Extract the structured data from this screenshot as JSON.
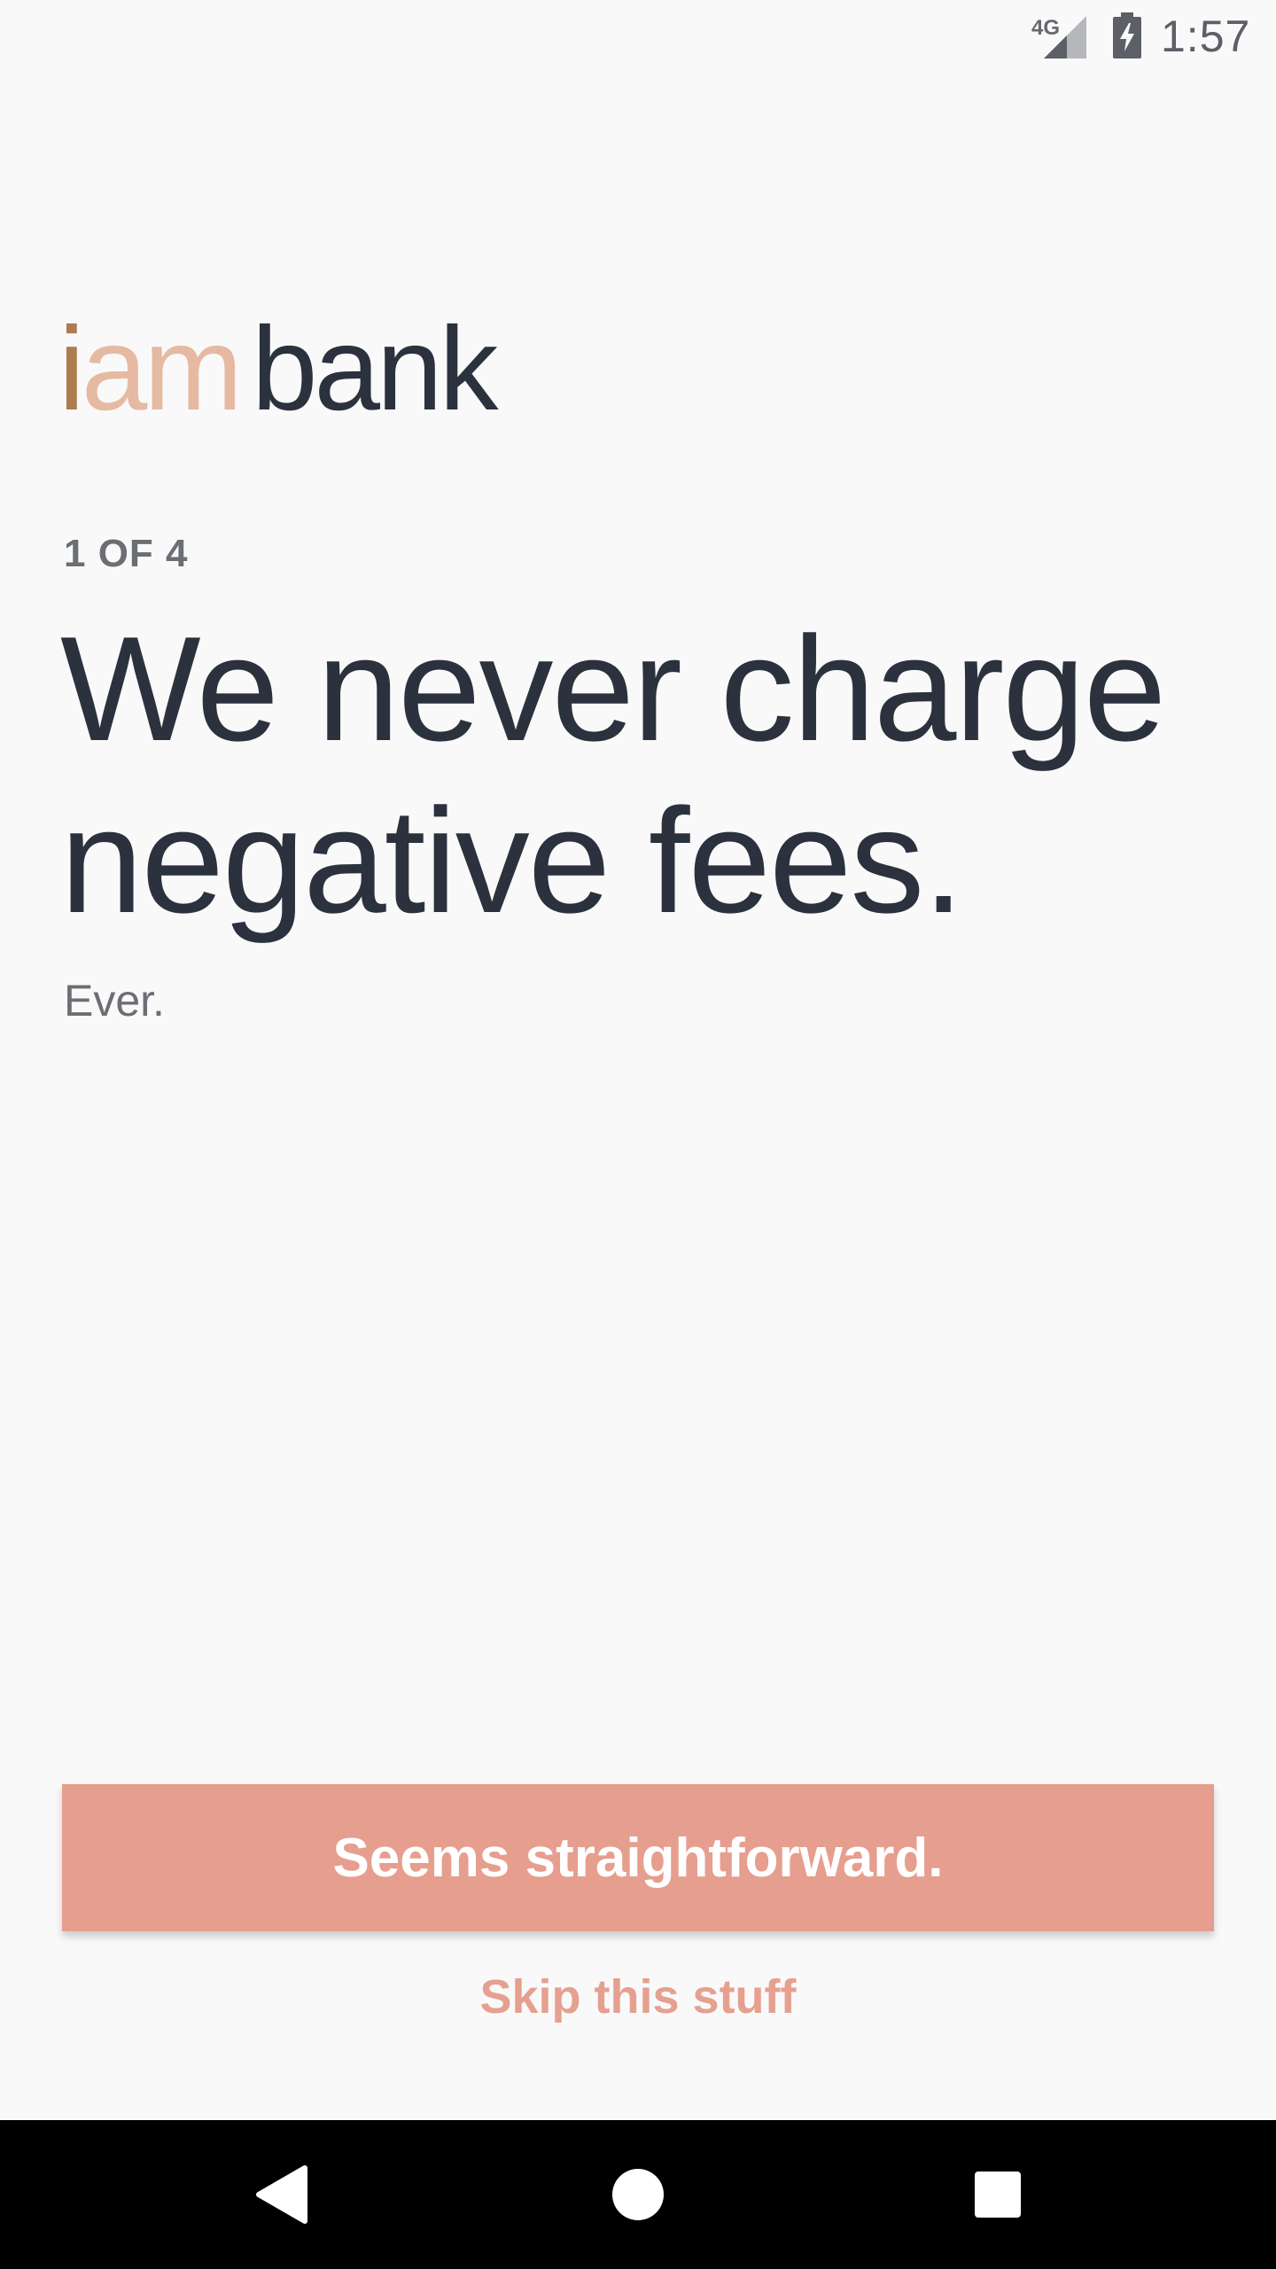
{
  "status_bar": {
    "network": "4G",
    "time": "1:57",
    "icons": [
      "signal-icon",
      "battery-charging-icon"
    ]
  },
  "logo": {
    "part_i": "i",
    "part_am": "am",
    "part_bank": "bank"
  },
  "onboarding": {
    "step": "1 OF 4",
    "headline": "We never charge negative fees.",
    "subtext": "Ever."
  },
  "actions": {
    "primary_label": "Seems straightforward.",
    "skip_label": "Skip this stuff"
  },
  "nav_bar": {
    "icons": [
      "back-icon",
      "home-icon",
      "recents-icon"
    ]
  },
  "colors": {
    "background": "#f9f9fa",
    "text_dark": "#2b323e",
    "text_muted": "#6b6e73",
    "accent": "#e69e8e",
    "logo_i": "#ad7c4f",
    "logo_am": "#e6b9a2"
  }
}
